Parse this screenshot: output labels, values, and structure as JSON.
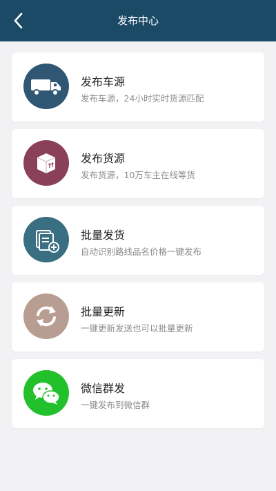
{
  "header": {
    "title": "发布中心",
    "back_icon": "chevron-left-icon"
  },
  "colors": {
    "header_bg": "#1b4a66",
    "truck_icon_bg": "#2f5672",
    "cargo_icon_bg": "#8a4058",
    "batch_icon_bg": "#3a6e82",
    "update_icon_bg": "#b89e92",
    "wechat_icon_bg": "#22c12b"
  },
  "cards": [
    {
      "title": "发布车源",
      "desc": "发布车源，24小时实时货源匹配",
      "icon": "truck-icon"
    },
    {
      "title": "发布货源",
      "desc": "发布货源，10万车主在线等货",
      "icon": "box-icon"
    },
    {
      "title": "批量发货",
      "desc": "自动识别路线品名价格一键发布",
      "icon": "document-add-icon"
    },
    {
      "title": "批量更新",
      "desc": "一键更新发送也可以批量更新",
      "icon": "refresh-icon"
    },
    {
      "title": "微信群发",
      "desc": "一键发布到微信群",
      "icon": "wechat-icon"
    }
  ]
}
